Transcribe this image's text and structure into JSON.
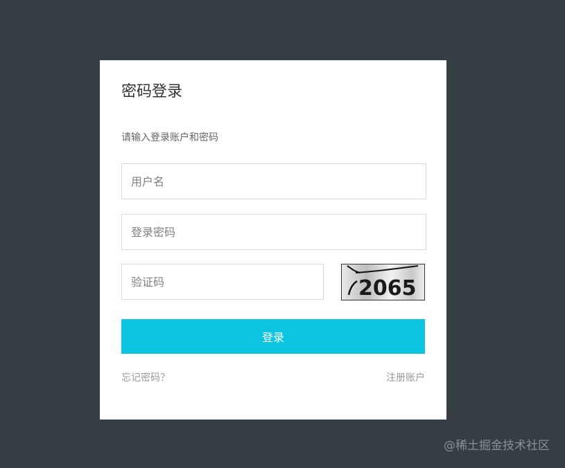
{
  "login": {
    "title": "密码登录",
    "subtitle": "请输入登录账户和密码",
    "username_placeholder": "用户名",
    "password_placeholder": "登录密码",
    "captcha_placeholder": "验证码",
    "captcha_text": "2065",
    "submit_label": "登录",
    "forgot_label": "忘记密码？",
    "register_label": "注册账户"
  },
  "watermark": "@稀土掘金技术社区",
  "colors": {
    "background": "#353e42",
    "card": "#ffffff",
    "accent": "#0bc5e0"
  }
}
